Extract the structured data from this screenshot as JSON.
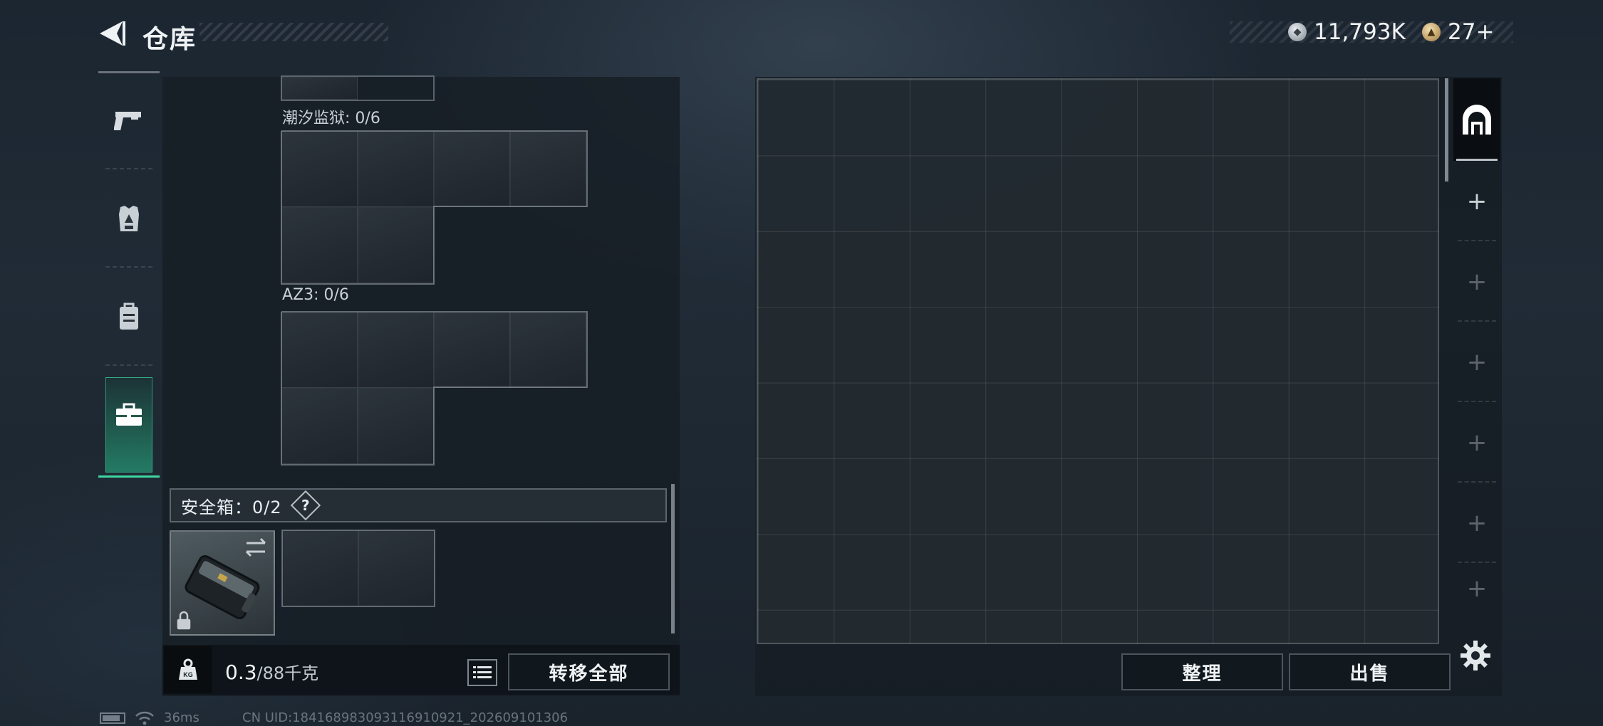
{
  "header": {
    "title": "仓库",
    "currencies": [
      {
        "icon": "silver-coin-icon",
        "value": "11,793K"
      },
      {
        "icon": "gold-coin-icon",
        "value": "27+"
      }
    ]
  },
  "left_tabs": [
    {
      "icon": "pistol-icon",
      "active": false
    },
    {
      "icon": "armor-vest-icon",
      "active": false
    },
    {
      "icon": "backpack-icon",
      "active": false
    },
    {
      "icon": "briefcase-icon",
      "active": true
    }
  ],
  "containers": [
    {
      "label": "潮汐监狱: 0/6"
    },
    {
      "label": "AZ3: 0/6"
    }
  ],
  "safe_box": {
    "label": "安全箱：0/2",
    "help": "?"
  },
  "weight": {
    "current": "0.3",
    "capacity": "/88千克"
  },
  "buttons": {
    "transfer_all": "转移全部",
    "sort": "整理",
    "sell": "出售"
  },
  "status_bar": {
    "ping": "36ms",
    "uid": "CN UID:184168983093116910921_202609101306"
  },
  "colors": {
    "accent": "#3fd7a1"
  }
}
